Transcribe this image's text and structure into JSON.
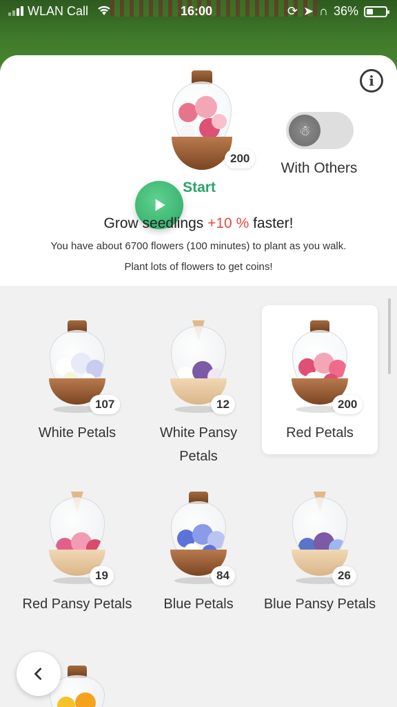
{
  "status_bar": {
    "carrier": "WLAN Call",
    "time": "16:00",
    "battery": "36%"
  },
  "hero": {
    "count": "200",
    "start_label": "Start",
    "toggle_label": "With Others"
  },
  "boost": {
    "prefix": "Grow seedlings ",
    "percent": "+10 %",
    "suffix": " faster!",
    "line2": "You have about 6700 flowers (100 minutes) to plant as you walk.",
    "line3": "Plant lots of flowers to get coins!"
  },
  "seedlings": [
    {
      "label": "White Petals",
      "count": "107",
      "bottle": "dark",
      "flowers": "white"
    },
    {
      "label": "White Pansy Petals",
      "count": "12",
      "bottle": "light",
      "flowers": "whitepansy"
    },
    {
      "label": "Red Petals",
      "count": "200",
      "bottle": "dark",
      "flowers": "red",
      "selected": true
    },
    {
      "label": "Red Pansy Petals",
      "count": "19",
      "bottle": "light",
      "flowers": "redpansy"
    },
    {
      "label": "Blue Petals",
      "count": "84",
      "bottle": "dark",
      "flowers": "blue"
    },
    {
      "label": "Blue Pansy Petals",
      "count": "26",
      "bottle": "light",
      "flowers": "bluepansy"
    }
  ],
  "colors": {
    "start_green": "#2aa36a",
    "percent_red": "#e24b3e"
  },
  "icons": {
    "info": "info-icon",
    "play": "play-icon",
    "walk": "walking-people-icon",
    "back": "chevron-left-icon"
  }
}
